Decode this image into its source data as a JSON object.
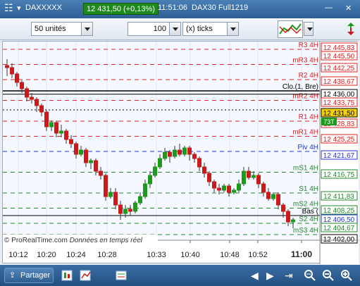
{
  "titlebar": {
    "symbol": "DAXXXXX",
    "price_badge": "12 431,50 (+0,13%)",
    "time": "11:51:06",
    "instrument": "DAX30 Full1219"
  },
  "toolbar": {
    "units_value": "50 unités",
    "qty_value": "100",
    "ticks_value": "(x) ticks"
  },
  "chart": {
    "watermark": "© ProRealTime.com",
    "watermark_sub": "Données en temps réel",
    "colors": {
      "up": "#1c9a1c",
      "down": "#cc1a1a",
      "resistance": "#dd2222",
      "support": "#22882a",
      "pivot": "#2233cc"
    }
  },
  "chart_data": {
    "type": "candlestick",
    "x_ticks": [
      "10:12",
      "10:20",
      "10:24",
      "10:28",
      "10:33",
      "10:40",
      "10:48",
      "10:52",
      "11:00"
    ],
    "y_ticks": [
      "12 445,83",
      "12 445,50",
      "12 442,25",
      "12 438,67",
      "12 436,00",
      "12 433,75",
      "12 431,50",
      "12 428,83",
      "12 425,25",
      "12 421,67",
      "12 416,75",
      "12 411,83",
      "12 408,25",
      "12 406,50",
      "12 404,67",
      "12 402,00"
    ],
    "current_price": "12 431,50",
    "current_tag": "73T",
    "levels": [
      {
        "label": "R3 4H",
        "value": 12445.83,
        "kind": "resistance"
      },
      {
        "label": "mR3 4H",
        "value": 12442.25,
        "kind": "resistance"
      },
      {
        "label": "R2 4H",
        "value": 12438.67,
        "kind": "resistance"
      },
      {
        "label": "Clo.(1, Bre)",
        "value": 12436.0,
        "kind": "close"
      },
      {
        "label": "mR2 4H",
        "value": 12433.75,
        "kind": "resistance"
      },
      {
        "label": "R1 4H",
        "value": 12428.83,
        "kind": "resistance"
      },
      {
        "label": "mR1 4H",
        "value": 12425.25,
        "kind": "resistance"
      },
      {
        "label": "Piv 4H",
        "value": 12421.67,
        "kind": "pivot"
      },
      {
        "label": "mS1 4H",
        "value": 12416.75,
        "kind": "support"
      },
      {
        "label": "S1 4H",
        "value": 12411.83,
        "kind": "support"
      },
      {
        "label": "mS2 4H",
        "value": 12408.25,
        "kind": "support"
      },
      {
        "label": "S2 4H",
        "value": 12404.67,
        "kind": "support"
      },
      {
        "label": "Bas (",
        "value": 12406.5,
        "kind": "low"
      },
      {
        "label": "mS3 4H",
        "value": 12402.0,
        "kind": "support"
      }
    ],
    "candles": [
      [
        12441.5,
        12442,
        12439.5,
        12443.5
      ],
      [
        12440,
        12441.5,
        12439,
        12442.5
      ],
      [
        12438,
        12440,
        12437,
        12440.5
      ],
      [
        12436.5,
        12438,
        12435.5,
        12438.5
      ],
      [
        12434.5,
        12436.5,
        12433.5,
        12437
      ],
      [
        12434,
        12434.5,
        12433,
        12435.5
      ],
      [
        12432.5,
        12434,
        12431,
        12434.5
      ],
      [
        12431,
        12432.5,
        12430,
        12433
      ],
      [
        12427.5,
        12431,
        12426.5,
        12431.5
      ],
      [
        12428.5,
        12427.5,
        12426.5,
        12429
      ],
      [
        12426,
        12428.5,
        12425,
        12429
      ],
      [
        12426.5,
        12426,
        12425,
        12428
      ],
      [
        12424.5,
        12426.5,
        12423.5,
        12427
      ],
      [
        12423.5,
        12424.5,
        12422.5,
        12425.5
      ],
      [
        12421,
        12423.5,
        12420,
        12424
      ],
      [
        12422,
        12421,
        12420.5,
        12423
      ],
      [
        12419,
        12422,
        12418,
        12422.5
      ],
      [
        12419.5,
        12419,
        12417.5,
        12420
      ],
      [
        12417,
        12419.5,
        12416,
        12420
      ],
      [
        12416,
        12417,
        12415,
        12418
      ],
      [
        12411,
        12416,
        12410,
        12416.5
      ],
      [
        12412,
        12411,
        12410.5,
        12413
      ],
      [
        12409,
        12412,
        12408,
        12413
      ],
      [
        12407,
        12409,
        12405.5,
        12410
      ],
      [
        12408,
        12407,
        12406,
        12409
      ],
      [
        12407.5,
        12408,
        12406.5,
        12409
      ],
      [
        12409.5,
        12407.5,
        12407,
        12410
      ],
      [
        12411,
        12409.5,
        12409,
        12412
      ],
      [
        12414,
        12411,
        12410.5,
        12415
      ],
      [
        12416,
        12414,
        12413,
        12417
      ],
      [
        12418,
        12416,
        12415.5,
        12419
      ],
      [
        12420,
        12418,
        12417.5,
        12421
      ],
      [
        12421.5,
        12420,
        12419.5,
        12422.5
      ],
      [
        12420.5,
        12421.5,
        12419,
        12422
      ],
      [
        12422,
        12420.5,
        12420,
        12423
      ],
      [
        12421,
        12422,
        12420.5,
        12423.5
      ],
      [
        12422.5,
        12421,
        12420.5,
        12423
      ],
      [
        12421,
        12422.5,
        12419.5,
        12423
      ],
      [
        12420,
        12421,
        12419,
        12421.5
      ],
      [
        12418,
        12420,
        12417,
        12420.5
      ],
      [
        12416.5,
        12418,
        12415.5,
        12419
      ],
      [
        12414.5,
        12416.5,
        12413.5,
        12417
      ],
      [
        12413,
        12414.5,
        12412,
        12415
      ],
      [
        12412.5,
        12413,
        12411.5,
        12414
      ],
      [
        12413.5,
        12412.5,
        12412,
        12414
      ],
      [
        12412,
        12413.5,
        12411,
        12414
      ],
      [
        12412.5,
        12412,
        12411.5,
        12413
      ],
      [
        12414,
        12412.5,
        12412,
        12415
      ],
      [
        12417,
        12414,
        12413.5,
        12418
      ],
      [
        12415.5,
        12417,
        12415,
        12418
      ],
      [
        12416,
        12415.5,
        12415,
        12417
      ],
      [
        12414,
        12416,
        12413,
        12416.5
      ],
      [
        12412,
        12414,
        12411,
        12414.5
      ],
      [
        12410.5,
        12412,
        12410,
        12413
      ],
      [
        12411.5,
        12410.5,
        12410,
        12412
      ],
      [
        12409,
        12411.5,
        12408,
        12412
      ],
      [
        12407.5,
        12409,
        12406,
        12409.5
      ],
      [
        12405,
        12407.5,
        12404,
        12408
      ],
      [
        12405.5,
        12405,
        12403.5,
        12406
      ]
    ]
  },
  "bottombar": {
    "share_label": "Partager"
  }
}
